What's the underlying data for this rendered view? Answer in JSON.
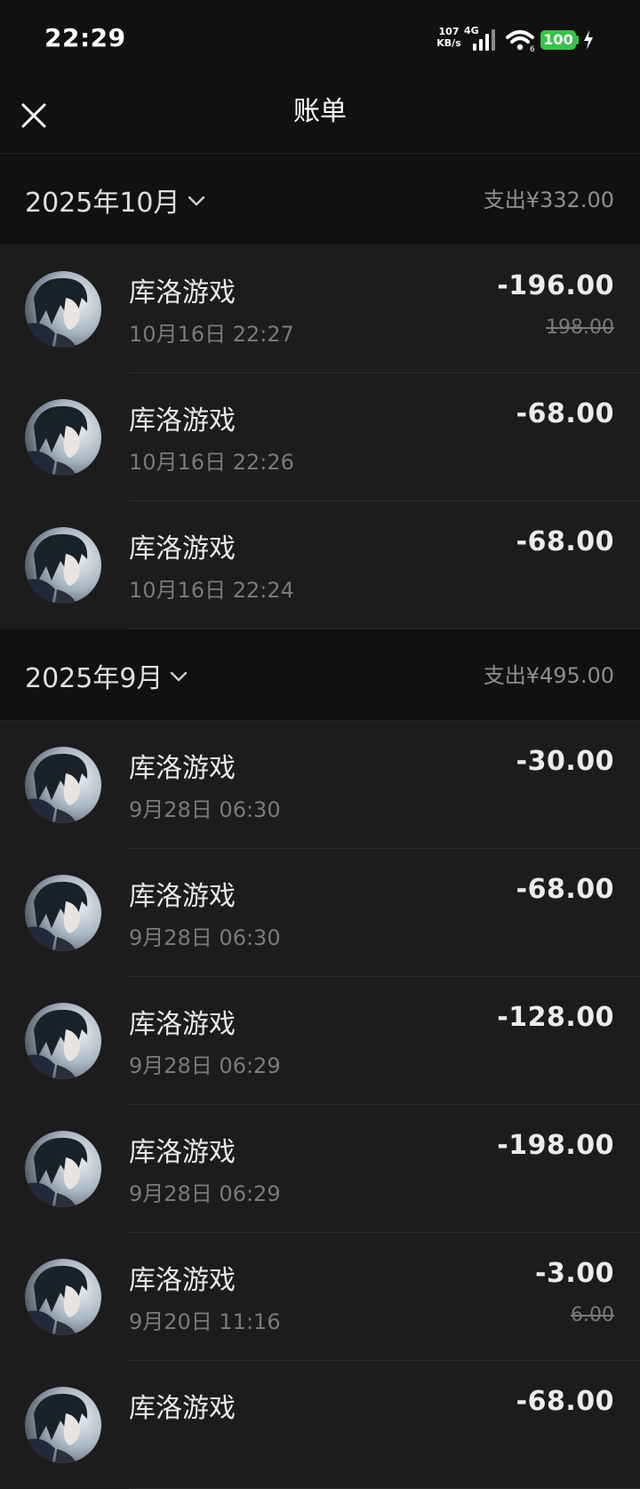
{
  "status_bar": {
    "time": "22:29",
    "net_speed_value": "107",
    "net_speed_unit": "KB/s",
    "net_type": "4G",
    "battery": "100",
    "icons": [
      "signal-icon",
      "wifi-icon",
      "charging-bolt-icon"
    ]
  },
  "nav": {
    "title": "账单",
    "close_icon": "close-icon"
  },
  "colors": {
    "background": "#1c1c1c",
    "header_background": "#111111",
    "battery": "#36c24a"
  },
  "months": [
    {
      "label": "2025年10月",
      "total": "支出¥332.00",
      "transactions": [
        {
          "merchant": "库洛游戏",
          "time": "10月16日 22:27",
          "amount": "-196.00",
          "original": "198.00"
        },
        {
          "merchant": "库洛游戏",
          "time": "10月16日 22:26",
          "amount": "-68.00"
        },
        {
          "merchant": "库洛游戏",
          "time": "10月16日 22:24",
          "amount": "-68.00"
        }
      ]
    },
    {
      "label": "2025年9月",
      "total": "支出¥495.00",
      "transactions": [
        {
          "merchant": "库洛游戏",
          "time": "9月28日 06:30",
          "amount": "-30.00"
        },
        {
          "merchant": "库洛游戏",
          "time": "9月28日 06:30",
          "amount": "-68.00"
        },
        {
          "merchant": "库洛游戏",
          "time": "9月28日 06:29",
          "amount": "-128.00"
        },
        {
          "merchant": "库洛游戏",
          "time": "9月28日 06:29",
          "amount": "-198.00"
        },
        {
          "merchant": "库洛游戏",
          "time": "9月20日 11:16",
          "amount": "-3.00",
          "original": "6.00"
        },
        {
          "merchant": "库洛游戏",
          "time": "",
          "amount": "-68.00"
        }
      ]
    }
  ]
}
